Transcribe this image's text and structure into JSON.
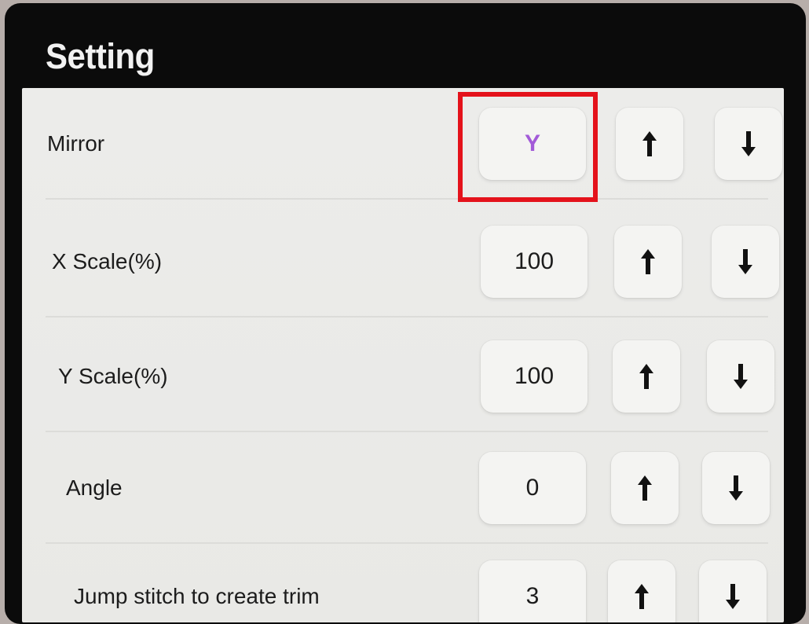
{
  "header": {
    "title": "Setting"
  },
  "rows": [
    {
      "label": "Mirror",
      "value": "Y"
    },
    {
      "label": "X Scale(%)",
      "value": "100"
    },
    {
      "label": "Y Scale(%)",
      "value": "100"
    },
    {
      "label": "Angle",
      "value": "0"
    },
    {
      "label": "Jump stitch to create trim",
      "value": "3"
    }
  ],
  "icons": {
    "increase": "arrow-up-icon",
    "decrease": "arrow-down-icon"
  },
  "colors": {
    "mirror_value": "#a25ad8",
    "highlight_border": "#e4121b",
    "header_bg": "#0b0b0b",
    "panel_bg": "#ececea"
  }
}
